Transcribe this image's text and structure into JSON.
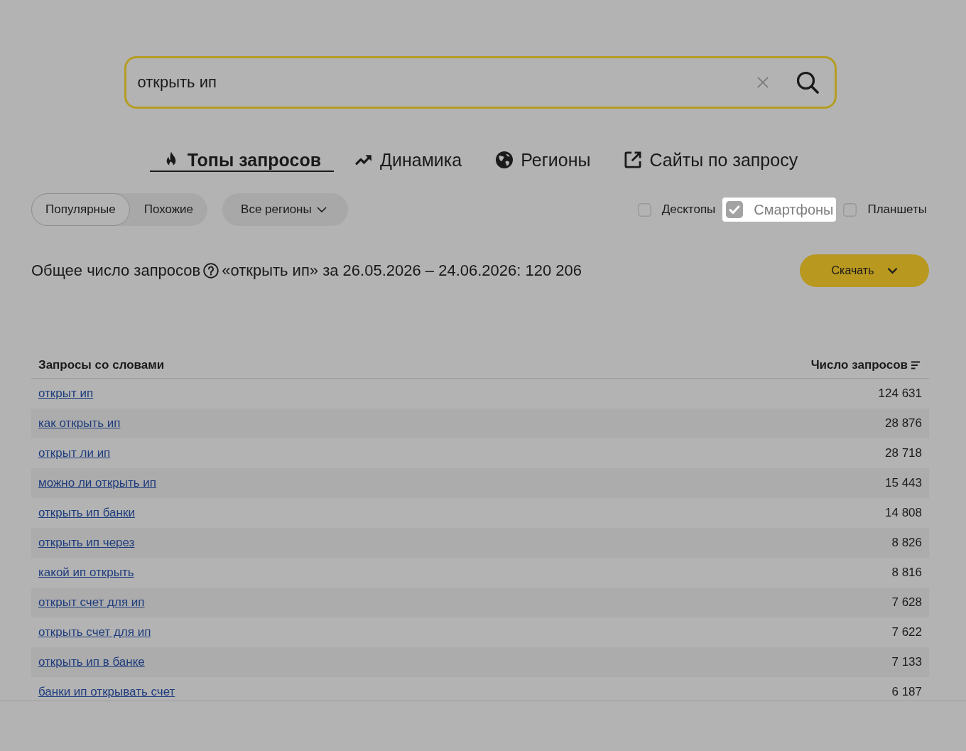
{
  "search": {
    "value": "открыть ип"
  },
  "tabs": [
    {
      "label": "Топы запросов",
      "selected": true
    },
    {
      "label": "Динамика",
      "selected": false
    },
    {
      "label": "Регионы",
      "selected": false
    },
    {
      "label": "Сайты по запросу",
      "selected": false
    }
  ],
  "mode_switch": [
    {
      "label": "Популярные",
      "selected": true
    },
    {
      "label": "Похожие",
      "selected": false
    }
  ],
  "region_dropdown": {
    "label": "Все регионы"
  },
  "devices": [
    {
      "label": "Десктопы",
      "checked": false,
      "highlighted": false
    },
    {
      "label": "Смартфоны",
      "checked": true,
      "highlighted": true
    },
    {
      "label": "Планшеты",
      "checked": false,
      "highlighted": false
    }
  ],
  "summary": {
    "label": "Общее число запросов",
    "text": "«открыть ип» за 26.05.2026 – 24.06.2026: 120 206"
  },
  "download_button": {
    "label": "Скачать"
  },
  "table": {
    "columns": [
      "Запросы со словами",
      "Число запросов"
    ],
    "rows": [
      {
        "query": "открыт ип",
        "count": "124 631"
      },
      {
        "query": "как открыть ип",
        "count": "28 876"
      },
      {
        "query": "открыт ли ип",
        "count": "28 718"
      },
      {
        "query": "можно ли открыть ип",
        "count": "15 443"
      },
      {
        "query": "открыть ип банки",
        "count": "14 808"
      },
      {
        "query": "открыть ип через",
        "count": "8 826"
      },
      {
        "query": "какой ип открыть",
        "count": "8 816"
      },
      {
        "query": "открыт счет для ип",
        "count": "7 628"
      },
      {
        "query": "открыть счет для ип",
        "count": "7 622"
      },
      {
        "query": "открыть ип в банке",
        "count": "7 133"
      },
      {
        "query": "банки ип открывать счет",
        "count": "6 187"
      }
    ]
  }
}
